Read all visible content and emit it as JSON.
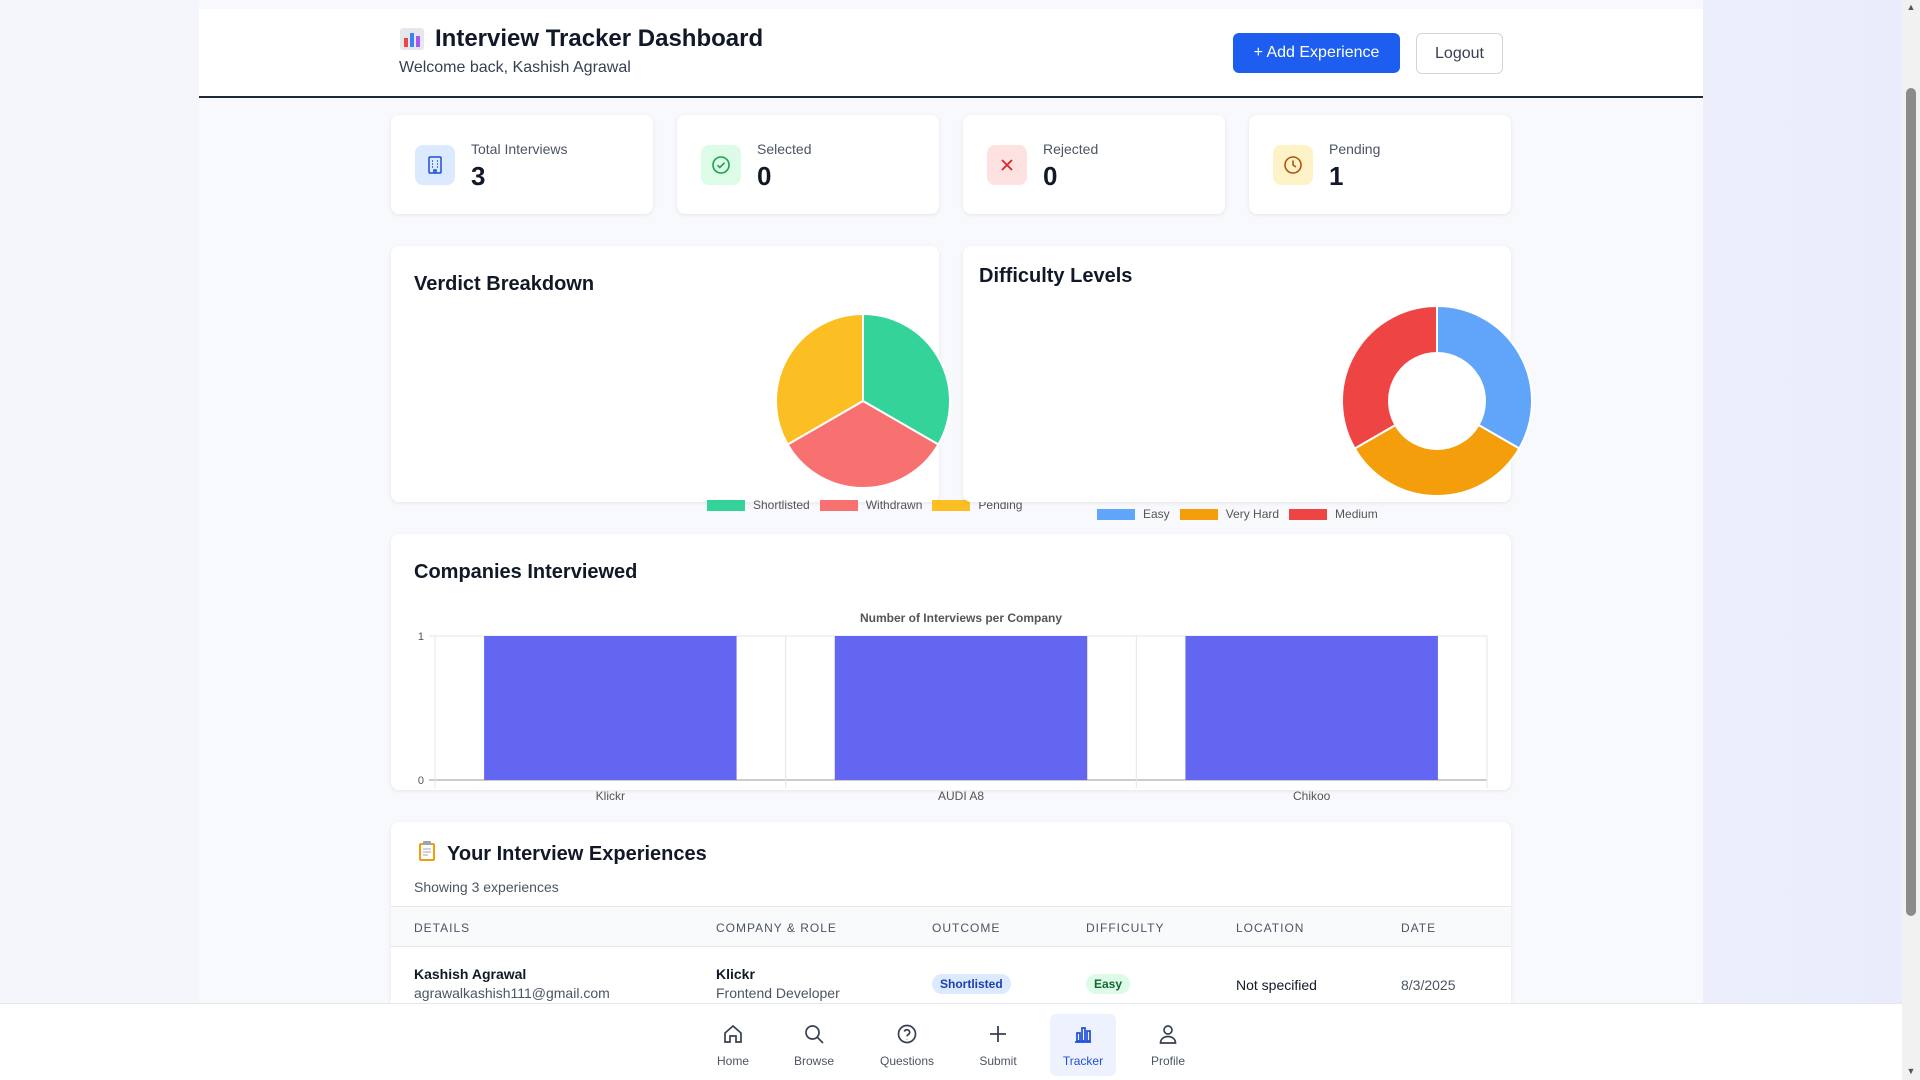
{
  "header": {
    "title": "Interview Tracker Dashboard",
    "subtitle": "Welcome back, Kashish Agrawal",
    "add_button": "+ Add Experience",
    "logout_button": "Logout"
  },
  "stats": [
    {
      "label": "Total Interviews",
      "value": "3",
      "icon": "building-icon"
    },
    {
      "label": "Selected",
      "value": "0",
      "icon": "check-circle-icon"
    },
    {
      "label": "Rejected",
      "value": "0",
      "icon": "x-icon"
    },
    {
      "label": "Pending",
      "value": "1",
      "icon": "clock-icon"
    }
  ],
  "verdict": {
    "title": "Verdict Breakdown",
    "chart_data": {
      "type": "pie",
      "categories": [
        "Shortlisted",
        "Withdrawn",
        "Pending"
      ],
      "values": [
        1,
        1,
        1
      ],
      "colors": [
        "#34d399",
        "#f87171",
        "#fbbf24"
      ],
      "legend": "bottom"
    }
  },
  "difficulty": {
    "title": "Difficulty Levels",
    "chart_data": {
      "type": "pie",
      "categories": [
        "Easy",
        "Very Hard",
        "Medium"
      ],
      "values": [
        1,
        1,
        1
      ],
      "colors": [
        "#60a5fa",
        "#f59e0b",
        "#ef4444"
      ],
      "donut": true,
      "legend": "bottom"
    }
  },
  "companies": {
    "title": "Companies Interviewed",
    "chart_data": {
      "type": "bar",
      "title": "Number of Interviews per Company",
      "categories": [
        "Klickr",
        "AUDI A8",
        "Chikoo"
      ],
      "values": [
        1,
        1,
        1
      ],
      "ylim": [
        0,
        1
      ],
      "yticks": [
        "0",
        "1"
      ],
      "color": "#6366f1",
      "grid": true
    }
  },
  "experiences": {
    "title": "Your Interview Experiences",
    "subtitle": "Showing 3 experiences",
    "columns": [
      "DETAILS",
      "COMPANY & ROLE",
      "OUTCOME",
      "DIFFICULTY",
      "LOCATION",
      "DATE"
    ],
    "rows": [
      {
        "name": "Kashish Agrawal",
        "email": "agrawalkashish111@gmail.com",
        "company": "Klickr",
        "role": "Frontend Developer",
        "outcome": "Shortlisted",
        "difficulty": "Easy",
        "location": "Not specified",
        "date": "8/3/2025"
      }
    ]
  },
  "nav": [
    {
      "label": "Home",
      "icon": "home-icon"
    },
    {
      "label": "Browse",
      "icon": "search-icon"
    },
    {
      "label": "Questions",
      "icon": "question-circle-icon"
    },
    {
      "label": "Submit",
      "icon": "plus-icon"
    },
    {
      "label": "Tracker",
      "icon": "bar-chart-icon",
      "active": true
    },
    {
      "label": "Profile",
      "icon": "user-icon"
    }
  ]
}
